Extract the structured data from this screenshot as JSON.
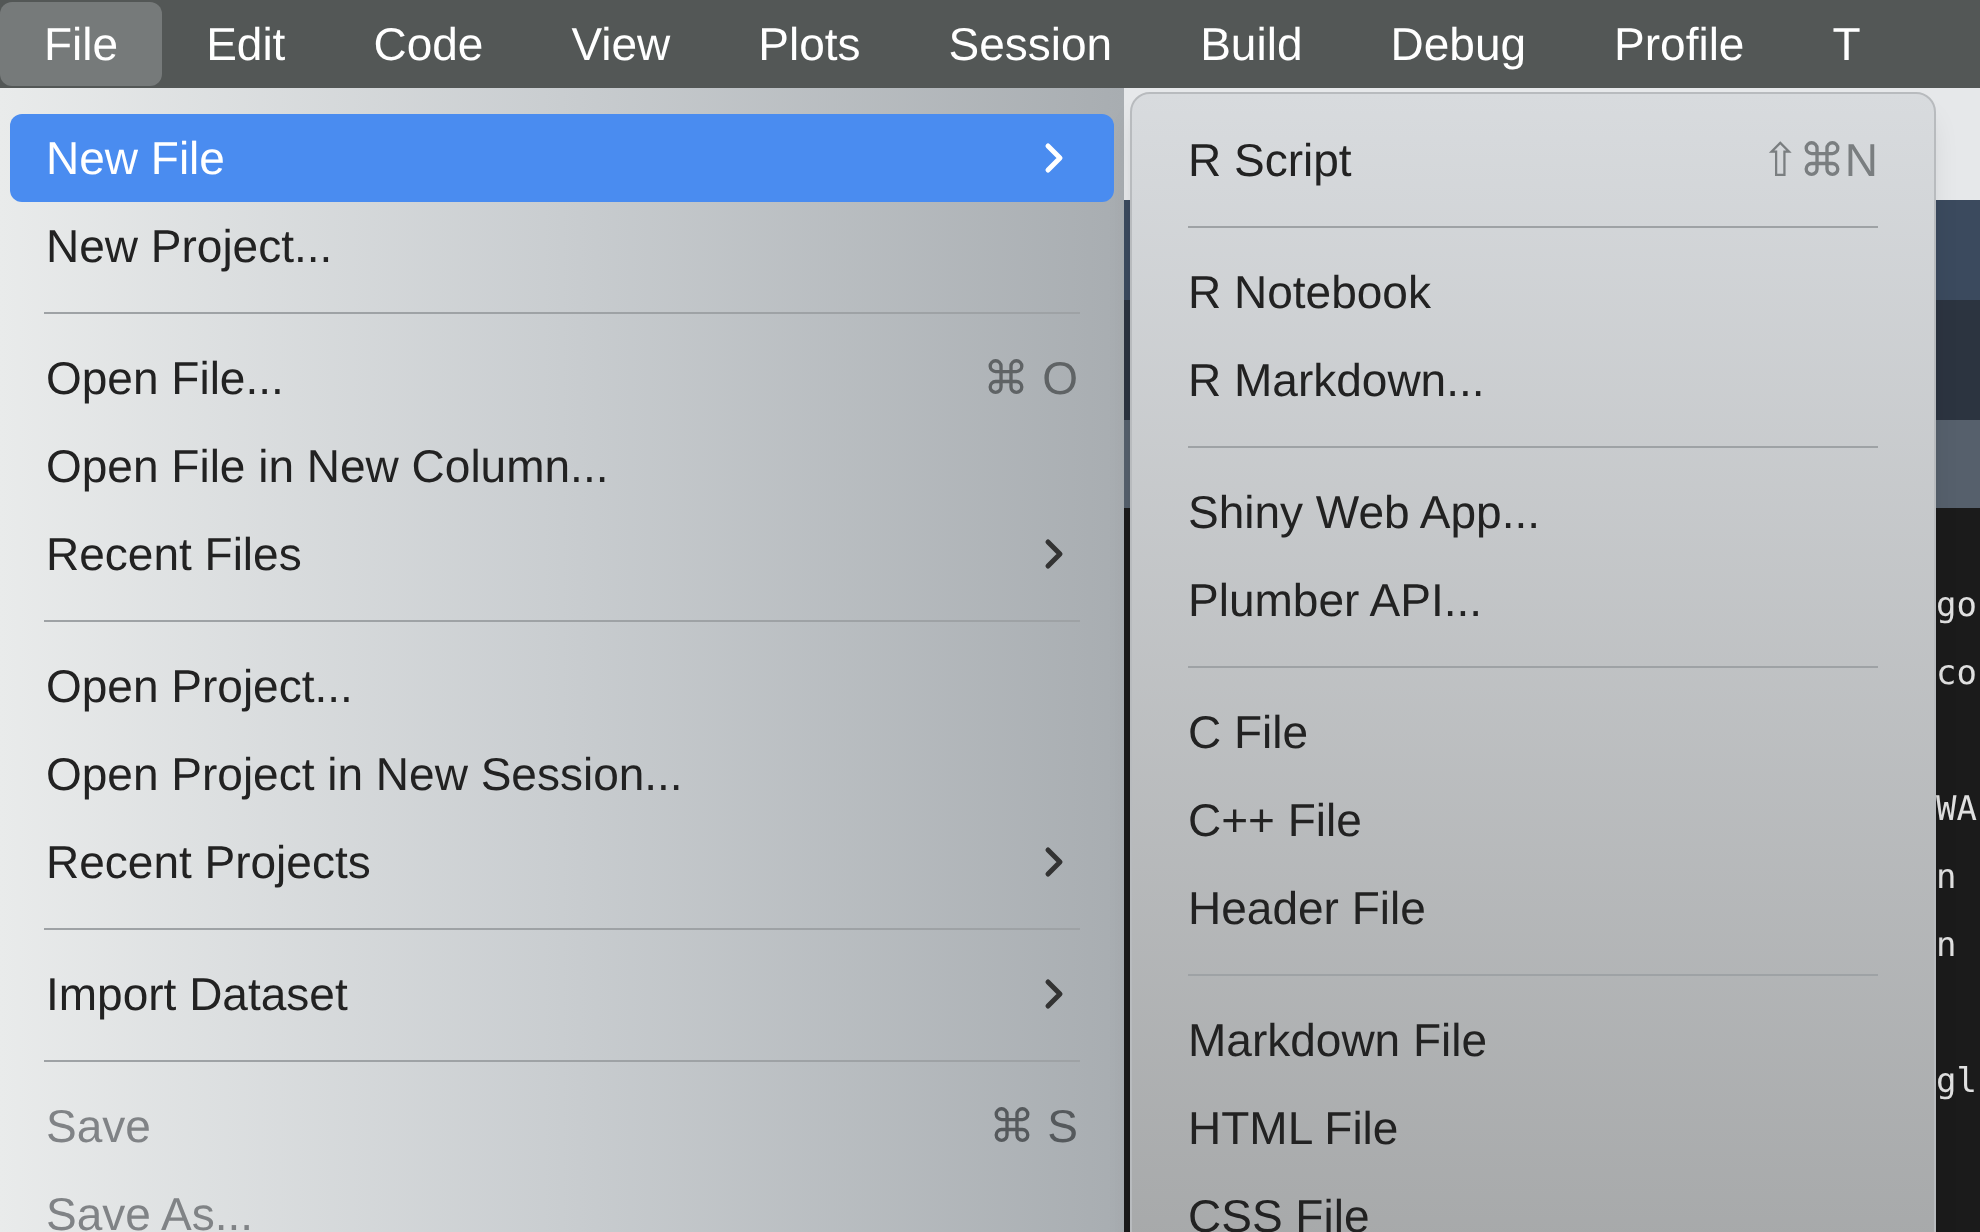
{
  "menu_bar": {
    "items": [
      {
        "label": "File",
        "selected": true
      },
      {
        "label": "Edit",
        "selected": false
      },
      {
        "label": "Code",
        "selected": false
      },
      {
        "label": "View",
        "selected": false
      },
      {
        "label": "Plots",
        "selected": false
      },
      {
        "label": "Session",
        "selected": false
      },
      {
        "label": "Build",
        "selected": false
      },
      {
        "label": "Debug",
        "selected": false
      },
      {
        "label": "Profile",
        "selected": false
      },
      {
        "label": "T",
        "selected": false
      }
    ]
  },
  "file_menu": {
    "items": [
      {
        "kind": "item",
        "label": "New File",
        "submenu": true,
        "selected": true,
        "disabled": false
      },
      {
        "kind": "item",
        "label": "New Project...",
        "submenu": false,
        "selected": false,
        "disabled": false
      },
      {
        "kind": "separator"
      },
      {
        "kind": "item",
        "label": "Open File...",
        "shortcut": "⌘ O",
        "submenu": false,
        "selected": false,
        "disabled": false
      },
      {
        "kind": "item",
        "label": "Open File in New Column...",
        "submenu": false,
        "selected": false,
        "disabled": false
      },
      {
        "kind": "item",
        "label": "Recent Files",
        "submenu": true,
        "selected": false,
        "disabled": false
      },
      {
        "kind": "separator"
      },
      {
        "kind": "item",
        "label": "Open Project...",
        "submenu": false,
        "selected": false,
        "disabled": false
      },
      {
        "kind": "item",
        "label": "Open Project in New Session...",
        "submenu": false,
        "selected": false,
        "disabled": false
      },
      {
        "kind": "item",
        "label": "Recent Projects",
        "submenu": true,
        "selected": false,
        "disabled": false
      },
      {
        "kind": "separator"
      },
      {
        "kind": "item",
        "label": "Import Dataset",
        "submenu": true,
        "selected": false,
        "disabled": false
      },
      {
        "kind": "separator"
      },
      {
        "kind": "item",
        "label": "Save",
        "shortcut": "⌘ S",
        "submenu": false,
        "selected": false,
        "disabled": true
      },
      {
        "kind": "item",
        "label": "Save As...",
        "submenu": false,
        "selected": false,
        "disabled": true
      }
    ]
  },
  "new_file_submenu": {
    "items": [
      {
        "kind": "item",
        "label": "R Script",
        "shortcut": "⇧⌘N"
      },
      {
        "kind": "separator"
      },
      {
        "kind": "item",
        "label": "R Notebook"
      },
      {
        "kind": "item",
        "label": "R Markdown..."
      },
      {
        "kind": "separator"
      },
      {
        "kind": "item",
        "label": "Shiny Web App..."
      },
      {
        "kind": "item",
        "label": "Plumber API..."
      },
      {
        "kind": "separator"
      },
      {
        "kind": "item",
        "label": "C File"
      },
      {
        "kind": "item",
        "label": "C++ File"
      },
      {
        "kind": "item",
        "label": "Header File"
      },
      {
        "kind": "separator"
      },
      {
        "kind": "item",
        "label": "Markdown File"
      },
      {
        "kind": "item",
        "label": "HTML File"
      },
      {
        "kind": "item",
        "label": "CSS File"
      }
    ]
  },
  "editor": {
    "code_paragraphs": [
      [
        "go",
        "co"
      ],
      [
        "WA",
        "n",
        "n"
      ],
      [
        "gl"
      ]
    ]
  }
}
